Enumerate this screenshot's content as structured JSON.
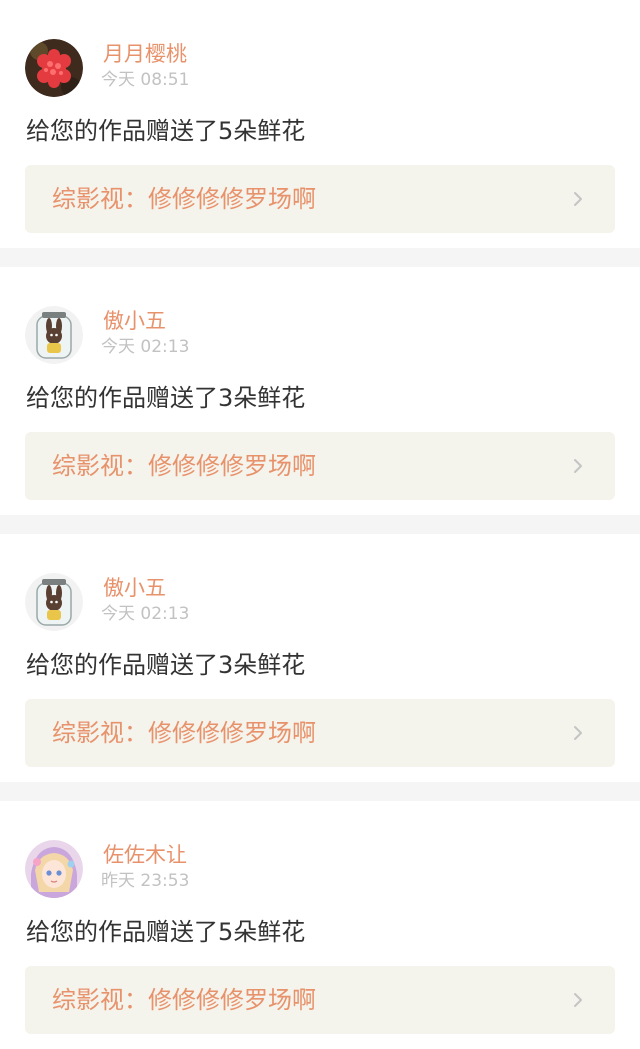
{
  "colors": {
    "name": "#e8926b",
    "work_title": "#e8926b",
    "time": "#c2c2c2",
    "message": "#333333",
    "link_bg": "#f4f3ec",
    "separator": "#f5f5f5",
    "indicator": "#f07fa0"
  },
  "notifications": [
    {
      "name": "月月樱桃",
      "time": "今天 08:51",
      "message": "给您的作品赠送了5朵鲜花",
      "work": "综影视：修修修修罗场啊",
      "avatar_icon": "red-flower-avatar-icon"
    },
    {
      "name": "傲小五",
      "time": "今天 02:13",
      "message": "给您的作品赠送了3朵鲜花",
      "work": "综影视：修修修修罗场啊",
      "avatar_icon": "bunny-in-jar-avatar-icon"
    },
    {
      "name": "傲小五",
      "time": "今天 02:13",
      "message": "给您的作品赠送了3朵鲜花",
      "work": "综影视：修修修修罗场啊",
      "avatar_icon": "bunny-in-jar-avatar-icon"
    },
    {
      "name": "佐佐木让",
      "time": "昨天 23:53",
      "message": "给您的作品赠送了5朵鲜花",
      "work": "综影视：修修修修罗场啊",
      "avatar_icon": "anime-girl-avatar-icon"
    }
  ]
}
